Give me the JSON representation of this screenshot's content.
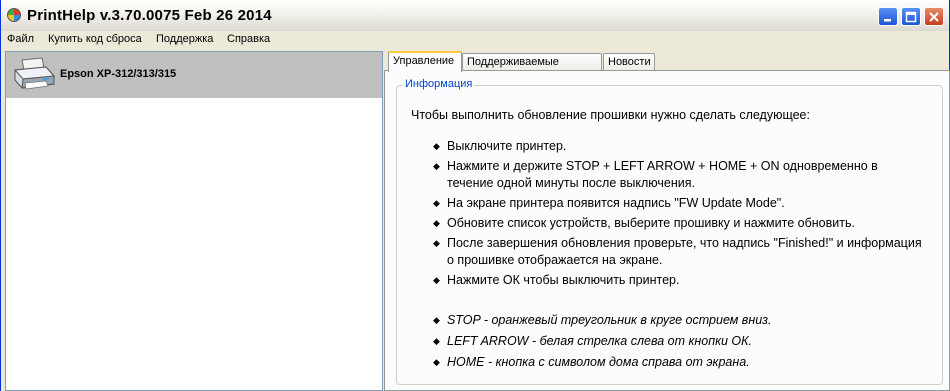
{
  "window": {
    "title": "PrintHelp v.3.70.0075 Feb 26 2014"
  },
  "menu": [
    "Файл",
    "Купить код сброса",
    "Поддержка",
    "Справка"
  ],
  "device": {
    "name": "Epson XP-312/313/315"
  },
  "tabs": [
    "Управление",
    "Поддерживаемые модели",
    "Новости"
  ],
  "info": {
    "group_title": "Информация",
    "intro": "Чтобы выполнить обновление прошивки нужно сделать следующее:",
    "steps": [
      "Выключите принтер.",
      "Нажмите и держите STOP + LEFT ARROW + HOME + ON одновременно в течение одной минуты после выключения.",
      "На экране принтера появится надпись \"FW Update Mode\".",
      "Обновите список устройств, выберите прошивку и нажмите обновить.",
      "После завершения обновления проверьте, что надпись \"Finished!\" и информация о прошивке отображается на экране.",
      "Нажмите ОК чтобы выключить принтер."
    ],
    "notes": [
      "STOP - оранжевый треугольник в круге острием вниз.",
      "LEFT ARROW - белая стрелка слева от кнопки ОК.",
      "HOME - кнопка с символом дома справа от экрана."
    ]
  },
  "icons": {
    "app": "app-logo-icon",
    "minimize": "minimize-icon",
    "maximize": "maximize-icon",
    "close": "close-icon",
    "printer": "printer-icon",
    "bullet": "◆"
  },
  "colors": {
    "accent_tab": "#ffc83c",
    "group_title": "#0046d5",
    "selected_row": "#c0c0c0"
  }
}
